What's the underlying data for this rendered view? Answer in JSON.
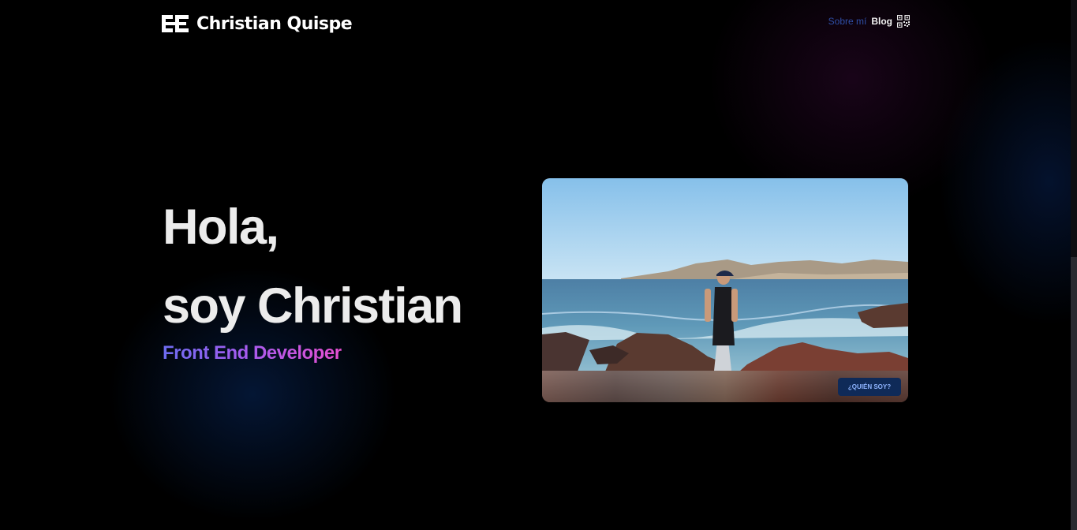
{
  "header": {
    "brand": "Christian Quispe",
    "nav": {
      "about_label": "Sobre mí",
      "blog_label": "Blog",
      "qr_icon": "qr-code-icon"
    }
  },
  "hero": {
    "greeting": "Hola,",
    "name_line": "soy Christian",
    "role": "Front End Developer"
  },
  "photo_card": {
    "button_label": "¿QUIÉN SOY?"
  },
  "colors": {
    "background": "#000000",
    "nav_link": "#2f4fa8",
    "role_gradient_start": "#6d6cf0",
    "role_gradient_end": "#e64fd0",
    "button_bg": "#0f2a58"
  }
}
